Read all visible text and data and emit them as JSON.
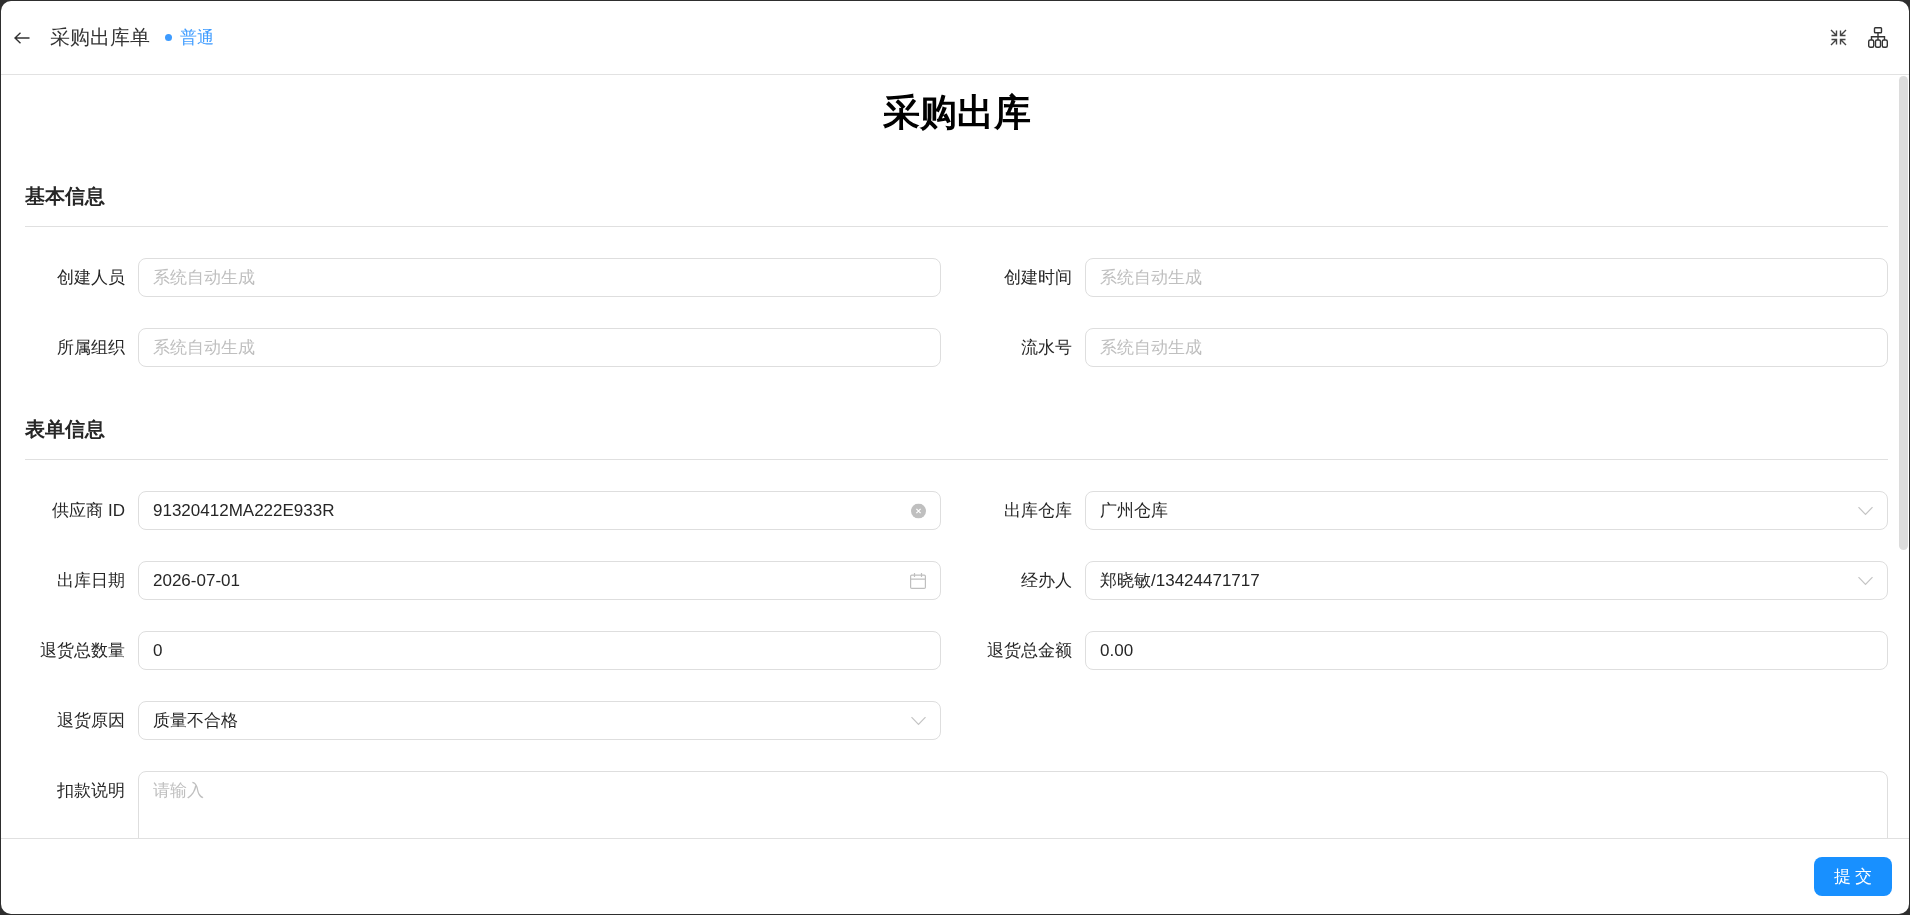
{
  "header": {
    "title": "采购出库单",
    "status": "普通"
  },
  "page_title": "采购出库",
  "sections": [
    {
      "title": "基本信息",
      "fields": [
        {
          "label": "创建人员",
          "kind": "input",
          "placeholder": "系统自动生成"
        },
        {
          "label": "创建时间",
          "kind": "input",
          "placeholder": "系统自动生成"
        },
        {
          "label": "所属组织",
          "kind": "input",
          "placeholder": "系统自动生成"
        },
        {
          "label": "流水号",
          "kind": "input",
          "placeholder": "系统自动生成"
        }
      ]
    },
    {
      "title": "表单信息",
      "fields": [
        {
          "label": "供应商 ID",
          "kind": "clearable",
          "value": "91320412MA222E933R"
        },
        {
          "label": "出库仓库",
          "kind": "select",
          "value": "广州仓库"
        },
        {
          "label": "出库日期",
          "kind": "date",
          "value": "2026-07-01"
        },
        {
          "label": "经办人",
          "kind": "select",
          "value": "郑晓敏/13424471717"
        },
        {
          "label": "退货总数量",
          "kind": "input",
          "value": "0"
        },
        {
          "label": "退货总金额",
          "kind": "input",
          "value": "0.00"
        },
        {
          "label": "退货原因",
          "kind": "select",
          "value": "质量不合格"
        },
        {
          "label": "扣款说明",
          "kind": "textarea",
          "placeholder": "请输入"
        }
      ]
    }
  ],
  "footer": {
    "submit": "提 交"
  }
}
